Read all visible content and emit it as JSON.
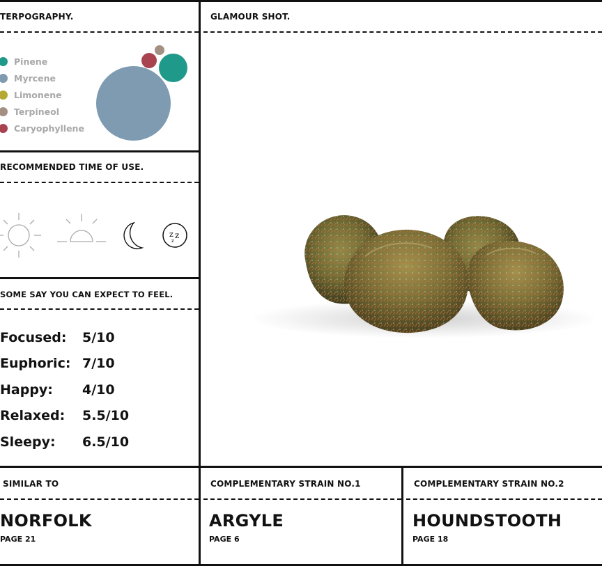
{
  "terpography": {
    "title": "TERPOGRAPHY.",
    "items": [
      {
        "label": "Pinene",
        "color": "#1f9a8a"
      },
      {
        "label": "Myrcene",
        "color": "#7f9bb1"
      },
      {
        "label": "Limonene",
        "color": "#b5a833"
      },
      {
        "label": "Terpineol",
        "color": "#a39082"
      },
      {
        "label": "Caryophyllene",
        "color": "#a8434f"
      }
    ]
  },
  "glamour": {
    "title": "GLAMOUR SHOT."
  },
  "time_of_use": {
    "title": "RECOMMENDED TIME OF USE.",
    "icons": [
      "sun-icon",
      "sunset-icon",
      "moon-icon",
      "sleep-icon"
    ]
  },
  "feel": {
    "title": "SOME SAY YOU CAN EXPECT TO FEEL.",
    "rows": [
      {
        "label": "Focused:",
        "value": "5/10"
      },
      {
        "label": "Euphoric:",
        "value": "7/10"
      },
      {
        "label": "Happy:",
        "value": "4/10"
      },
      {
        "label": "Relaxed:",
        "value": "5.5/10"
      },
      {
        "label": "Sleepy:",
        "value": "6.5/10"
      }
    ]
  },
  "similar": {
    "title": "SIMILAR TO",
    "name": "NORFOLK",
    "page": "PAGE 21"
  },
  "complementary_1": {
    "title": "COMPLEMENTARY STRAIN NO.1",
    "name": "ARGYLE",
    "page": "PAGE 6"
  },
  "complementary_2": {
    "title": "COMPLEMENTARY STRAIN NO.2",
    "name": "HOUNDSTOOTH",
    "page": "PAGE 18"
  }
}
